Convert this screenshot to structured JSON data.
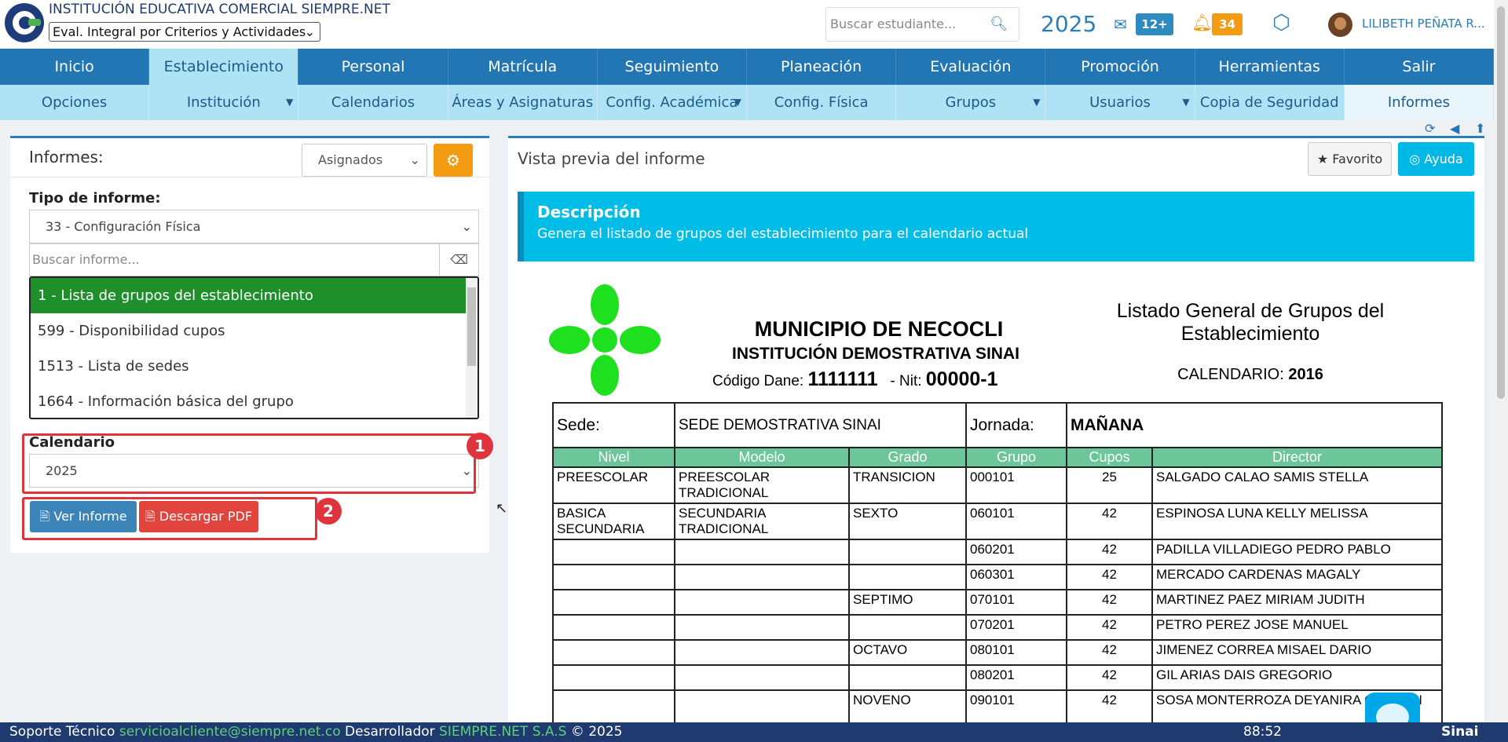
{
  "header": {
    "institution": "INSTITUCIÓN EDUCATIVA COMERCIAL SIEMPRE.NET",
    "eval_mode": "Eval. Integral por Criterios y Actividades",
    "search_placeholder": "Buscar estudiante...",
    "year": "2025",
    "messages_badge": "12+",
    "notifications_badge": "34",
    "user_name": "LILIBETH PEÑATA R..."
  },
  "nav_main": [
    "Inicio",
    "Establecimiento",
    "Personal",
    "Matrícula",
    "Seguimiento",
    "Planeación",
    "Evaluación",
    "Promoción",
    "Herramientas",
    "Salir"
  ],
  "nav_sub": [
    "Opciones",
    "Institución",
    "Calendarios",
    "Áreas y Asignaturas",
    "Config. Académica",
    "Config. Física",
    "Grupos",
    "Usuarios",
    "Copia de Seguridad",
    "Informes"
  ],
  "left": {
    "title": "Informes:",
    "filter": "Asignados",
    "tipo_label": "Tipo de informe:",
    "tipo_value": "33 - Configuración Física",
    "search_placeholder": "Buscar informe...",
    "reports": [
      "1 - Lista de grupos del establecimiento",
      "599 - Disponibilidad cupos",
      "1513 - Lista de sedes",
      "1664 - Información básica del grupo"
    ],
    "calendar_label": "Calendario",
    "calendar_value": "2025",
    "ver_label": "Ver Informe",
    "pdf_label": "Descargar PDF",
    "marker1": "1",
    "marker2": "2"
  },
  "right": {
    "title": "Vista previa del informe",
    "fav_label": "Favorito",
    "help_label": "Ayuda",
    "desc_title": "Descripción",
    "desc_text": "Genera el listado de grupos del establecimiento para el calendario actual"
  },
  "report": {
    "municipio": "MUNICIPIO DE NECOCLI",
    "institucion": "INSTITUCIÓN DEMOSTRATIVA SINAI",
    "dane_label": "Código Dane:",
    "dane_value": "1111111",
    "nit_label": "- Nit:",
    "nit_value": "00000-1",
    "title": "Listado General de Grupos del Establecimiento",
    "calendar_label": "CALENDARIO:",
    "calendar_value": "2016",
    "sede_label": "Sede:",
    "sede_value": "SEDE DEMOSTRATIVA SINAI",
    "jornada_label": "Jornada:",
    "jornada_value": "MAÑANA",
    "columns": [
      "Nivel",
      "Modelo",
      "Grado",
      "Grupo",
      "Cupos",
      "Director"
    ],
    "rows": [
      [
        "PREESCOLAR",
        "PREESCOLAR TRADICIONAL",
        "TRANSICION",
        "000101",
        "25",
        "SALGADO CALAO SAMIS STELLA"
      ],
      [
        "BASICA SECUNDARIA",
        "SECUNDARIA TRADICIONAL",
        "SEXTO",
        "060101",
        "42",
        "ESPINOSA LUNA KELLY MELISSA"
      ],
      [
        "",
        "",
        "",
        "060201",
        "42",
        "PADILLA VILLADIEGO PEDRO PABLO"
      ],
      [
        "",
        "",
        "",
        "060301",
        "42",
        "MERCADO CARDENAS MAGALY"
      ],
      [
        "",
        "",
        "SEPTIMO",
        "070101",
        "42",
        "MARTINEZ PAEZ MIRIAM JUDITH"
      ],
      [
        "",
        "",
        "",
        "070201",
        "42",
        "PETRO PEREZ JOSE MANUEL"
      ],
      [
        "",
        "",
        "OCTAVO",
        "080101",
        "42",
        "JIMENEZ CORREA MISAEL DARIO"
      ],
      [
        "",
        "",
        "",
        "080201",
        "42",
        "GIL ARIAS DAIS GREGORIO"
      ],
      [
        "",
        "",
        "NOVENO",
        "090101",
        "42",
        "SOSA MONTERROZA DEYANIRA CARMEN"
      ]
    ]
  },
  "footer": {
    "support_label": "Soporte Técnico",
    "support_email": "servicioalcliente@siempre.net.co",
    "dev_label": "Desarrollador",
    "dev_name": "SIEMPRE.NET S.A.S",
    "copyright": "© 2025",
    "timer": "88:52",
    "brand": "Sinai"
  },
  "colors": {
    "nav_blue": "#2276b4",
    "subnav": "#aee2f5",
    "highlight_red": "#e0343c",
    "selected_green": "#1f8f2b",
    "header_green": "#6cc69a"
  },
  "icons": [
    "search-icon",
    "envelope-icon",
    "bell-icon",
    "cube-icon",
    "gears-icon",
    "eraser-icon",
    "refresh-icon",
    "back-icon",
    "up-icon",
    "star-icon",
    "lifebuoy-icon",
    "file-icon",
    "pdf-icon",
    "chat-icon"
  ]
}
